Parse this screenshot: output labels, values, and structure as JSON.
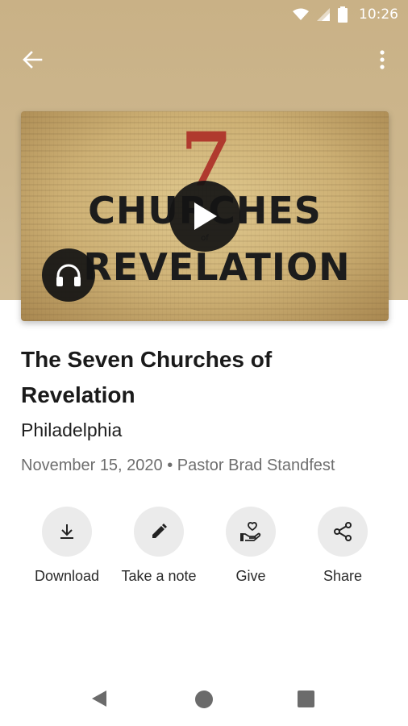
{
  "status_bar": {
    "time": "10:26"
  },
  "hero": {
    "artwork_number": "7",
    "artwork_line1": "CHURCHES",
    "artwork_of": "of",
    "artwork_line2": "REVELATION"
  },
  "sermon": {
    "title": "The Seven Churches of Revelation",
    "subtitle": "Philadelphia",
    "meta": "November 15, 2020 • Pastor Brad Standfest"
  },
  "actions": [
    {
      "label": "Download",
      "icon": "download-icon"
    },
    {
      "label": "Take a note",
      "icon": "pencil-icon"
    },
    {
      "label": "Give",
      "icon": "give-hand-heart-icon"
    },
    {
      "label": "Share",
      "icon": "share-icon"
    }
  ],
  "colors": {
    "header_tan": "#c9b186",
    "artwork_red": "#b03a2e",
    "action_circle": "#ebebeb",
    "meta_gray": "#6e6e6e"
  }
}
